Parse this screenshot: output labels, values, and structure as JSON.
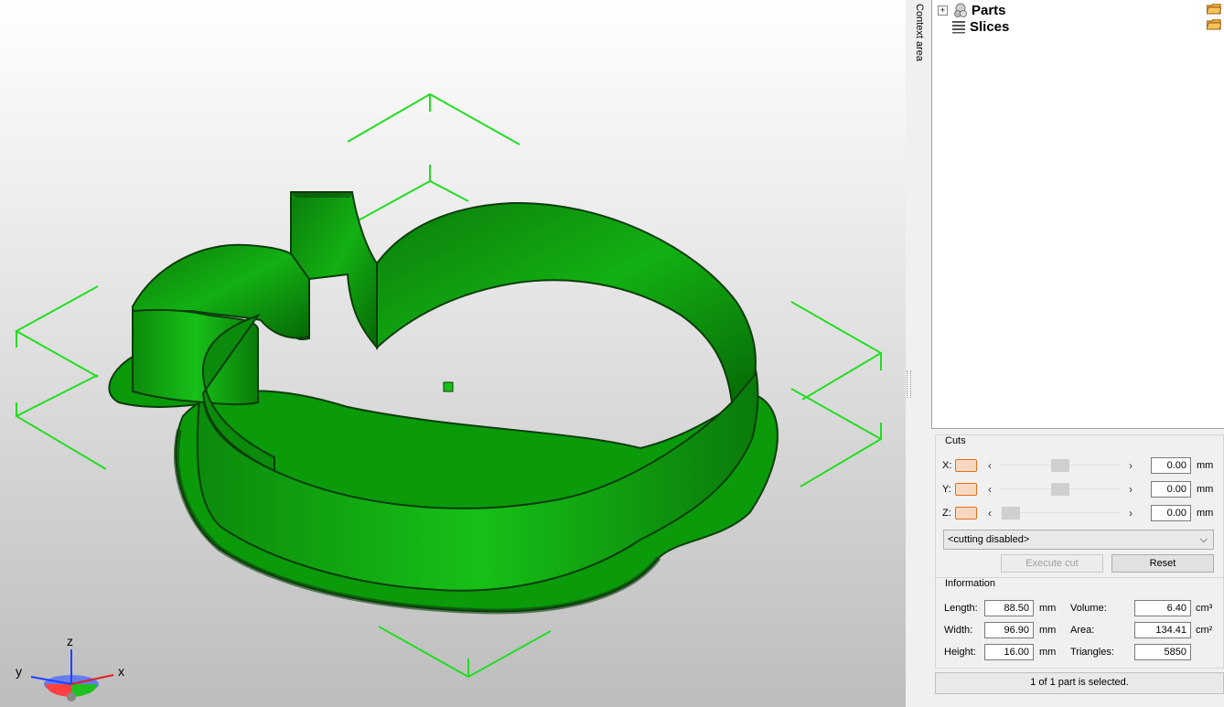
{
  "viewport": {
    "gizmo": {
      "x_label": "x",
      "y_label": "y",
      "z_label": "z"
    }
  },
  "context_tab": "Context area",
  "tree": {
    "items": [
      {
        "label": "Parts",
        "icon": "parts-icon",
        "expander": "+"
      },
      {
        "label": "Slices",
        "icon": "slices-icon"
      }
    ]
  },
  "cuts": {
    "title": "Cuts",
    "axes": [
      {
        "label": "X:",
        "value": "0.00",
        "unit": "mm",
        "position": 0.5
      },
      {
        "label": "Y:",
        "value": "0.00",
        "unit": "mm",
        "position": 0.5
      },
      {
        "label": "Z:",
        "value": "0.00",
        "unit": "mm",
        "position": 0.0
      }
    ],
    "mode_select": "<cutting disabled>",
    "execute_label": "Execute cut",
    "reset_label": "Reset"
  },
  "information": {
    "title": "Information",
    "length_label": "Length:",
    "length_value": "88.50",
    "length_unit": "mm",
    "width_label": "Width:",
    "width_value": "96.90",
    "width_unit": "mm",
    "height_label": "Height:",
    "height_value": "16.00",
    "height_unit": "mm",
    "volume_label": "Volume:",
    "volume_value": "6.40",
    "volume_unit": "cm³",
    "area_label": "Area:",
    "area_value": "134.41",
    "area_unit": "cm²",
    "triangles_label": "Triangles:",
    "triangles_value": "5850"
  },
  "status": "1 of 1 part is selected.",
  "colors": {
    "model": "#0aa60a",
    "bbox": "#22dd22",
    "orange": "#e07020"
  }
}
